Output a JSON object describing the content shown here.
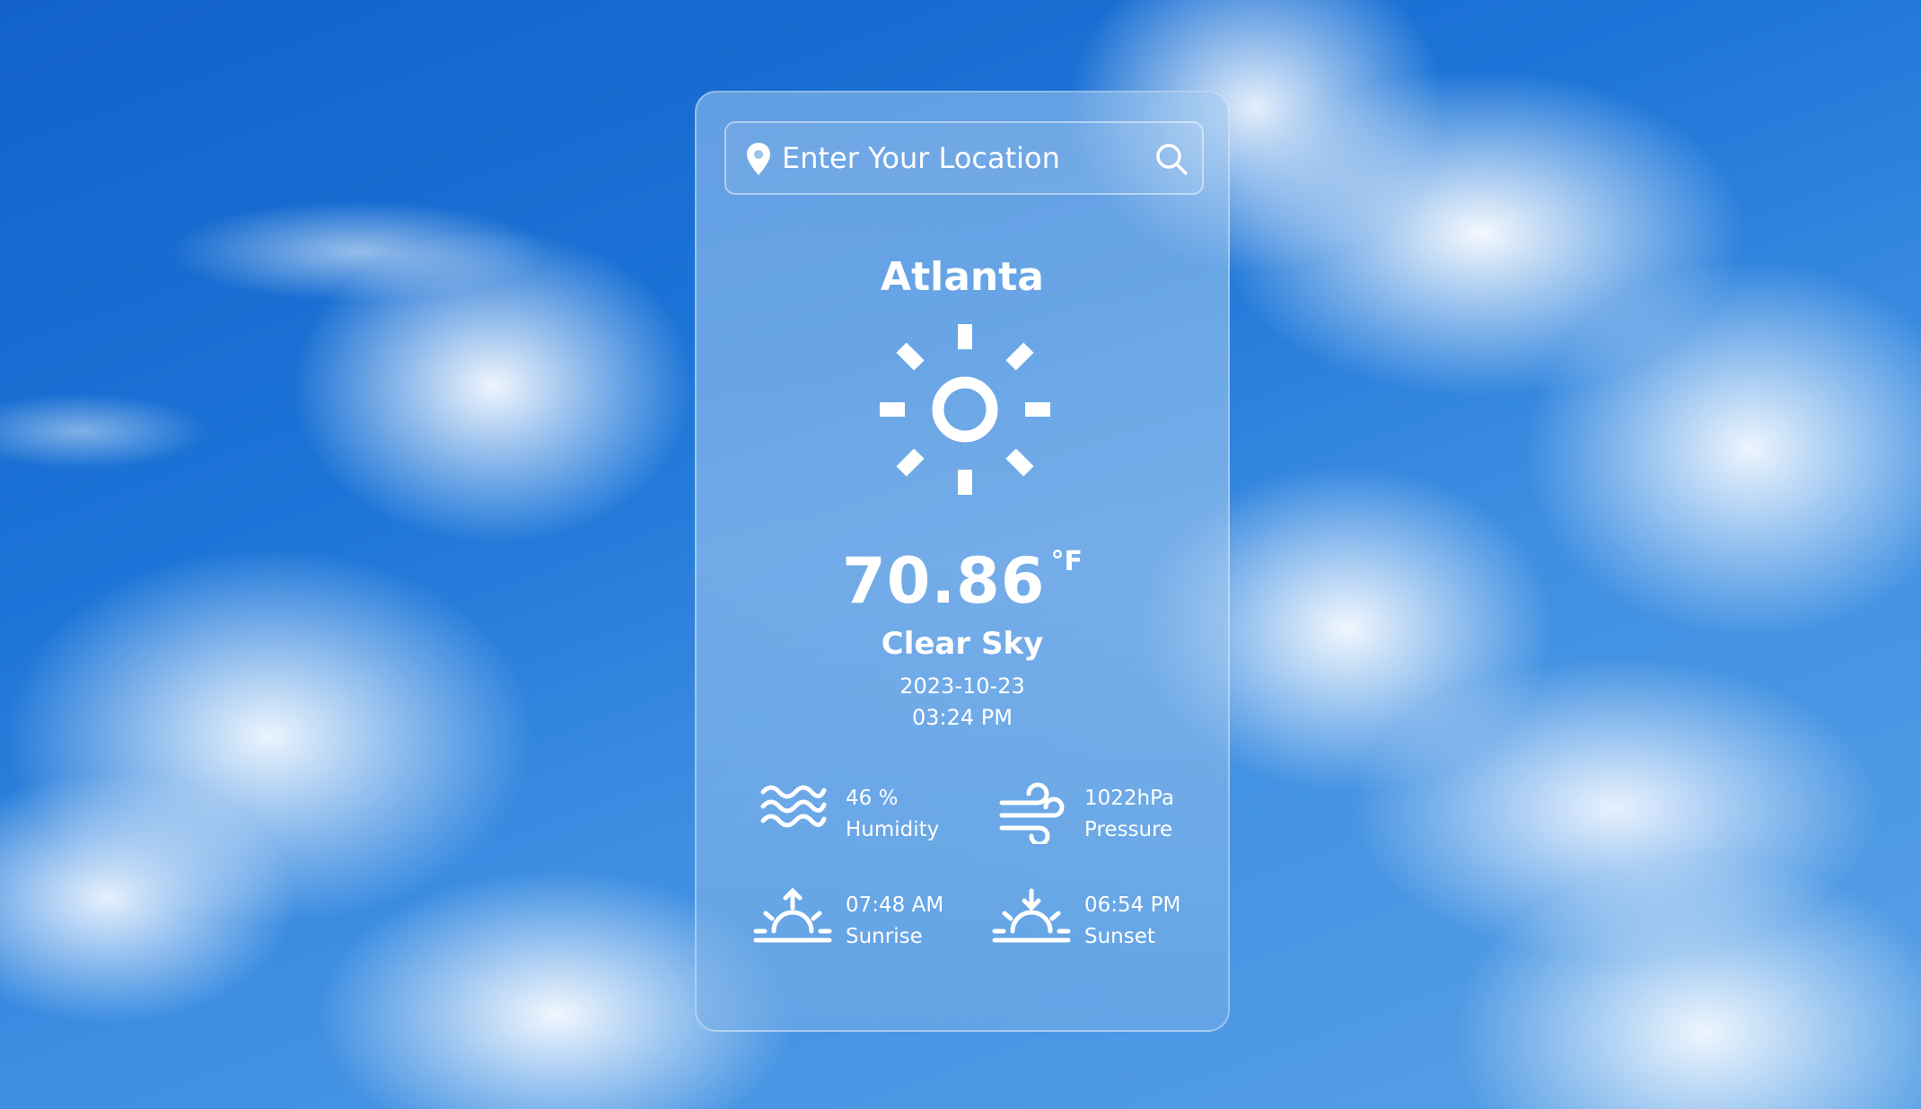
{
  "search": {
    "placeholder": "Enter Your Location",
    "pin_icon": "location-pin-icon",
    "search_icon": "search-icon"
  },
  "weather": {
    "city": "Atlanta",
    "icon": "sun-icon",
    "temperature": "70.86",
    "unit": "°F",
    "condition": "Clear Sky",
    "date": "2023-10-23",
    "time": "03:24 PM"
  },
  "stats": {
    "humidity": {
      "value": "46 %",
      "label": "Humidity",
      "icon": "waves-icon"
    },
    "pressure": {
      "value": "1022hPa",
      "label": "Pressure",
      "icon": "wind-icon"
    },
    "sunrise": {
      "value": "07:48 AM",
      "label": "Sunrise",
      "icon": "sunrise-icon"
    },
    "sunset": {
      "value": "06:54 PM",
      "label": "Sunset",
      "icon": "sunset-icon"
    }
  },
  "colors": {
    "text": "#ffffff",
    "sky": "#1d75d8"
  }
}
